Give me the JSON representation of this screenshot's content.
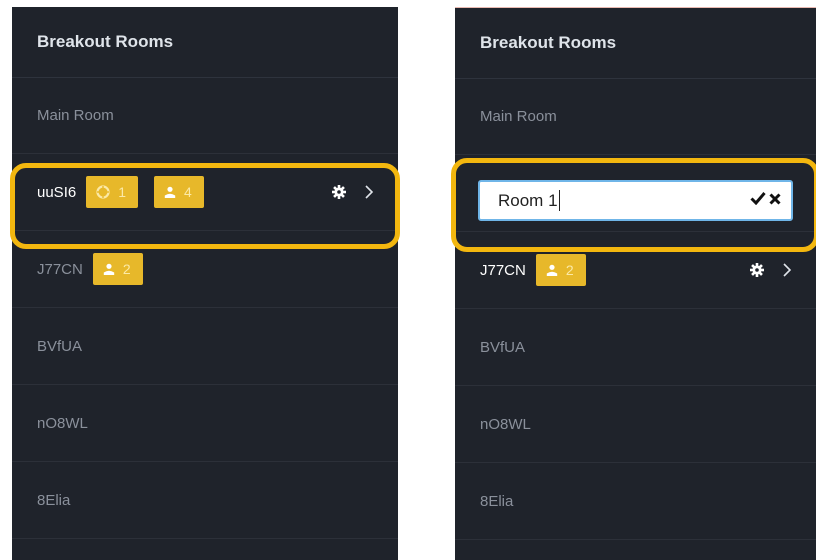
{
  "left_panel": {
    "title": "Breakout Rooms",
    "main_room": "Main Room",
    "rooms": [
      {
        "name": "uuSI6",
        "lifebuoy_count": "1",
        "user_count": "4"
      },
      {
        "name": "J77CN",
        "user_count": "2"
      },
      {
        "name": "BVfUA"
      },
      {
        "name": "nO8WL"
      },
      {
        "name": "8Elia"
      }
    ]
  },
  "right_panel": {
    "title": "Breakout Rooms",
    "main_room": "Main Room",
    "edit_input_value": "Room 1",
    "rooms": [
      {
        "name": "J77CN",
        "user_count": "2"
      },
      {
        "name": "BVfUA"
      },
      {
        "name": "nO8WL"
      },
      {
        "name": "8Elia"
      }
    ]
  },
  "icons": {
    "lifebuoy": "lifebuoy-icon",
    "user": "user-icon",
    "gear": "gear-icon",
    "chevron": "chevron-right-icon",
    "check": "check-icon",
    "close": "close-icon"
  },
  "colors": {
    "panel_bg": "#1f232b",
    "badge": "#e7b82a",
    "highlight": "#f3b70f",
    "input_focus": "#6fb5e8"
  }
}
